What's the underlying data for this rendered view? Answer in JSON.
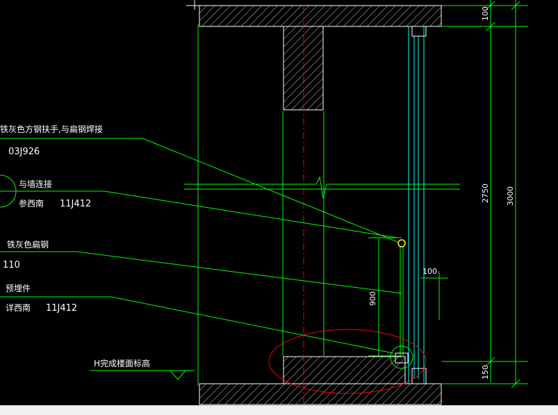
{
  "annotations": {
    "handrail": "铁灰色方钢扶手,与扁钢焊接",
    "handrail_ref": "03J926",
    "wall_connect": "与墙连接",
    "wall_connect_ref_prefix": "参西南",
    "wall_connect_ref": "11J412",
    "flat_steel": "铁灰色扁钢",
    "flat_steel_size": "110",
    "embedded": "预埋件",
    "embedded_ref_prefix": "详西南",
    "embedded_ref": "11J412",
    "floor_level": "H完成楼面标高"
  },
  "dimensions": {
    "top_slab": "100",
    "middle": "2750",
    "total": "3000",
    "bottom": "150",
    "rail_height": "900",
    "offset": "100"
  },
  "colors": {
    "green": "#00ff00",
    "white": "#ffffff",
    "cyan": "#00ffff",
    "red": "#ff0000",
    "yellow": "#ffff00"
  }
}
